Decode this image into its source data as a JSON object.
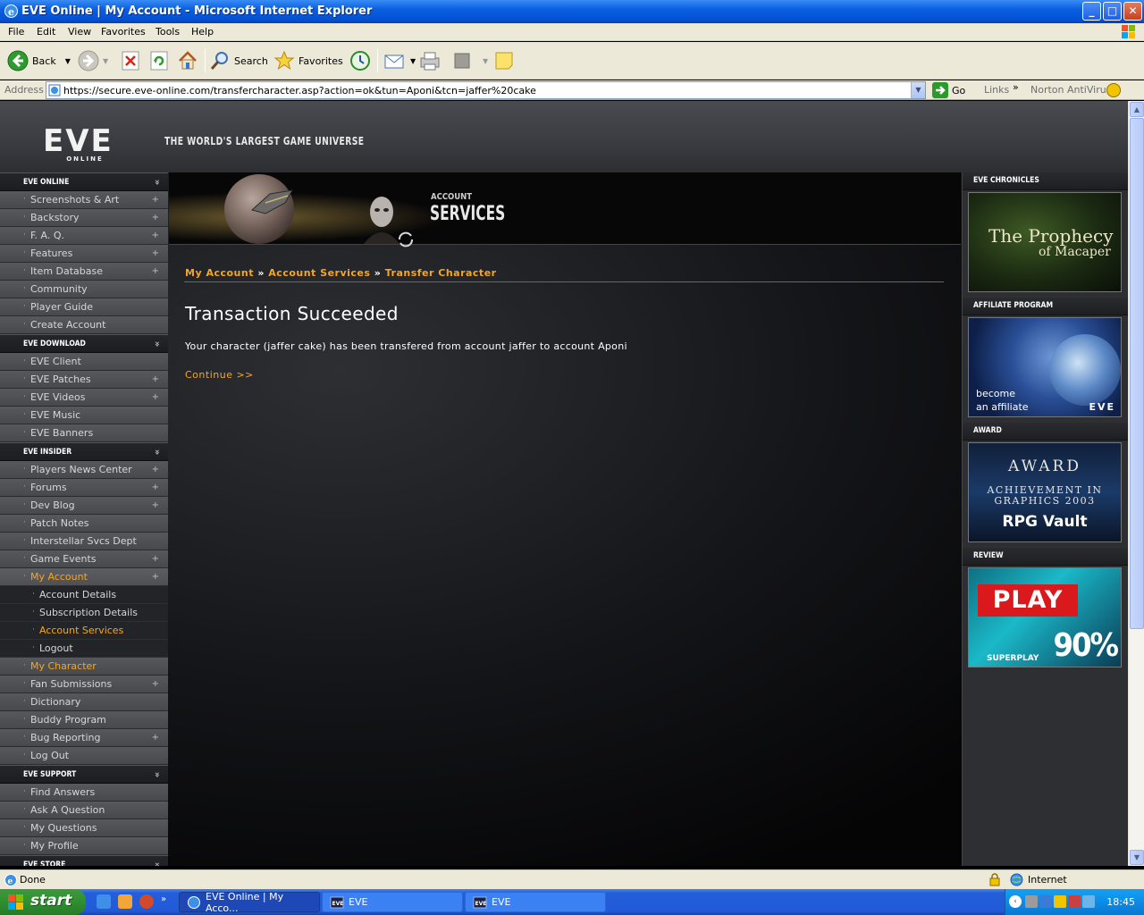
{
  "window": {
    "title": "EVE Online | My Account - Microsoft Internet Explorer",
    "buttons": {
      "minimize": "_",
      "maximize": "□",
      "close": "✕"
    }
  },
  "menubar": [
    "File",
    "Edit",
    "View",
    "Favorites",
    "Tools",
    "Help"
  ],
  "toolbar": {
    "back_label": "Back",
    "search_label": "Search",
    "favorites_label": "Favorites"
  },
  "address": {
    "label": "Address",
    "url": "https://secure.eve-online.com/transfercharacter.asp?action=ok&tun=Aponi&tcn=jaffer%20cake",
    "go_label": "Go",
    "links_label": "Links",
    "norton_label": "Norton AntiVirus"
  },
  "header": {
    "logo_text": "EVE",
    "logo_sub": "ONLINE",
    "tagline": "THE WORLD'S LARGEST GAME UNIVERSE"
  },
  "nav": {
    "sections": [
      {
        "title": "EVE ONLINE",
        "items": [
          {
            "label": "Screenshots & Art",
            "plus": true
          },
          {
            "label": "Backstory",
            "plus": true
          },
          {
            "label": "F. A. Q.",
            "plus": true
          },
          {
            "label": "Features",
            "plus": true
          },
          {
            "label": "Item Database",
            "plus": true
          },
          {
            "label": "Community",
            "plus": false
          },
          {
            "label": "Player Guide",
            "plus": false
          },
          {
            "label": "Create Account",
            "plus": false
          }
        ]
      },
      {
        "title": "EVE DOWNLOAD",
        "items": [
          {
            "label": "EVE Client",
            "plus": false
          },
          {
            "label": "EVE Patches",
            "plus": true
          },
          {
            "label": "EVE Videos",
            "plus": true
          },
          {
            "label": "EVE Music",
            "plus": false
          },
          {
            "label": "EVE Banners",
            "plus": false
          }
        ]
      },
      {
        "title": "EVE INSIDER",
        "items": [
          {
            "label": "Players News Center",
            "plus": true
          },
          {
            "label": "Forums",
            "plus": true
          },
          {
            "label": "Dev Blog",
            "plus": true
          },
          {
            "label": "Patch Notes",
            "plus": false
          },
          {
            "label": "Interstellar Svcs Dept",
            "plus": false
          },
          {
            "label": "Game Events",
            "plus": true
          },
          {
            "label": "My Account",
            "plus": true,
            "active": true
          },
          {
            "label": "Account Details",
            "sub": true
          },
          {
            "label": "Subscription Details",
            "sub": true
          },
          {
            "label": "Account Services",
            "sub": true,
            "orange": true
          },
          {
            "label": "Logout",
            "sub": true
          },
          {
            "label": "My Character",
            "plus": false,
            "orange": true
          },
          {
            "label": "Fan Submissions",
            "plus": true
          },
          {
            "label": "Dictionary",
            "plus": false
          },
          {
            "label": "Buddy Program",
            "plus": false
          },
          {
            "label": "Bug Reporting",
            "plus": true
          },
          {
            "label": "Log Out",
            "plus": false
          }
        ]
      },
      {
        "title": "EVE SUPPORT",
        "items": [
          {
            "label": "Find Answers",
            "plus": false
          },
          {
            "label": "Ask A Question",
            "plus": false
          },
          {
            "label": "My Questions",
            "plus": false
          },
          {
            "label": "My Profile",
            "plus": false
          }
        ]
      },
      {
        "title": "EVE STORE",
        "items": []
      }
    ]
  },
  "banner": {
    "account_label": "ACCOUNT",
    "services_label": "SERVICES"
  },
  "breadcrumb": {
    "items": [
      "My Account",
      "Account Services",
      "Transfer Character"
    ],
    "separator": "»"
  },
  "content": {
    "heading": "Transaction Succeeded",
    "message": "Your character (jaffer cake) has been transfered from account jaffer to account Aponi",
    "continue_label": "Continue >>"
  },
  "rightcol": {
    "chronicles_title": "EVE CHRONICLES",
    "chronicles_line1": "The Prophecy",
    "chronicles_line2": "of Macaper",
    "affiliate_title": "AFFILIATE PROGRAM",
    "affiliate_line1": "become",
    "affiliate_line2": "an affiliate",
    "affiliate_logo": "EVE",
    "award_title": "AWARD",
    "award_line1": "AWARD",
    "award_line2": "ACHIEVEMENT IN",
    "award_line3": "GRAPHICS 2003",
    "award_line4": "RPG Vault",
    "review_title": "REVIEW",
    "review_logo": "PLAY",
    "review_sub": "SUPERPLAY",
    "review_score": "90%"
  },
  "status": {
    "text": "Done",
    "zone": "Internet"
  },
  "taskbar": {
    "start_label": "start",
    "tasks": [
      "EVE Online | My Acco...",
      "EVE",
      "EVE"
    ],
    "clock": "18:45"
  },
  "colors": {
    "accent_orange": "#f5a623",
    "xp_blue": "#245edb"
  }
}
